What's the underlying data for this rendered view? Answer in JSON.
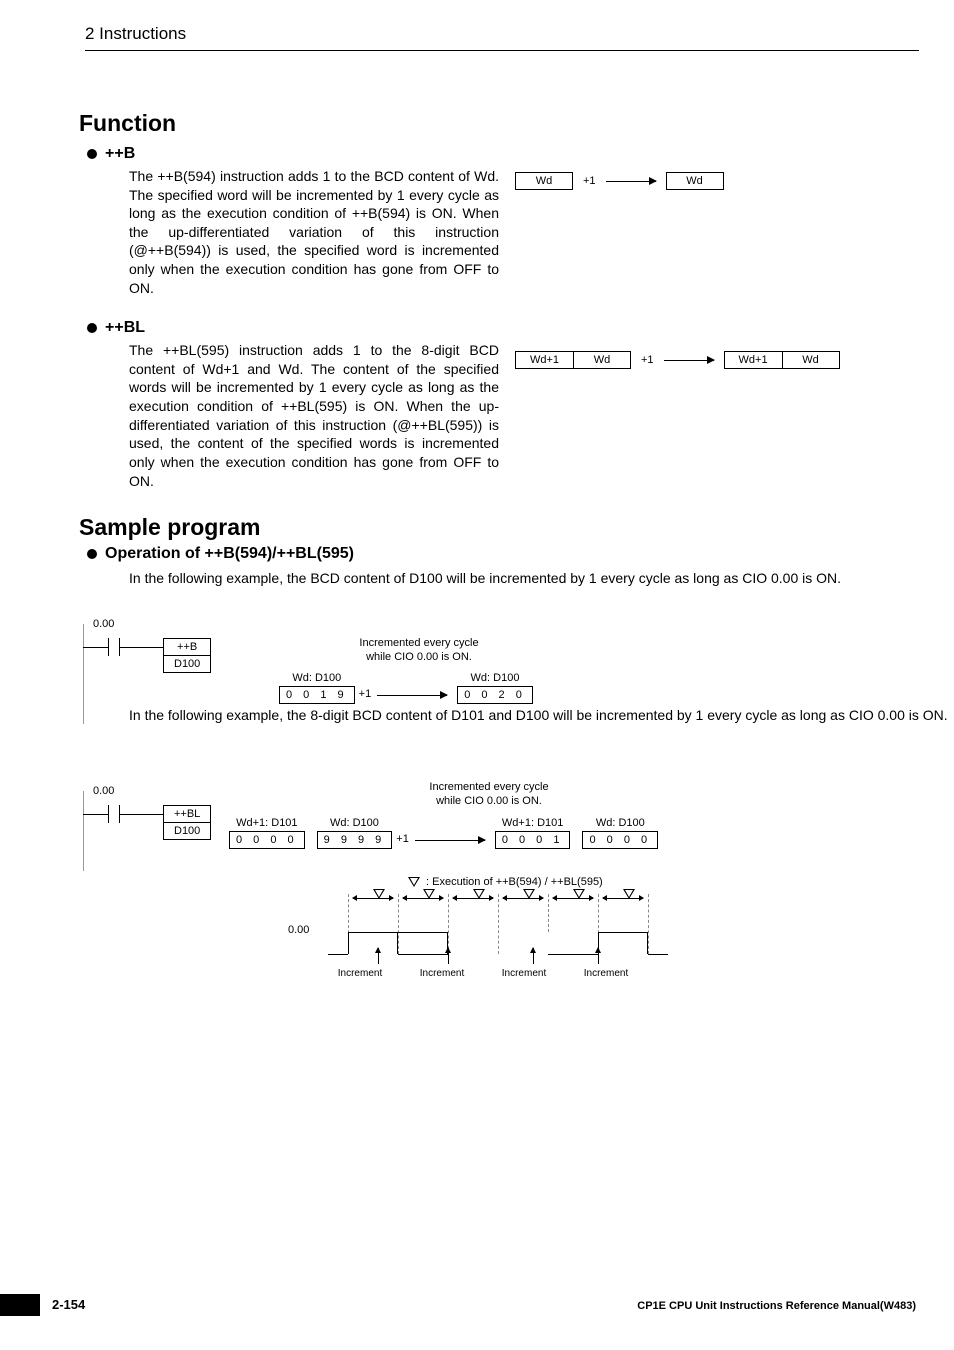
{
  "header": {
    "chapter_title": "2   Instructions"
  },
  "sections": {
    "function_heading": "Function",
    "ppB": {
      "title": "++B",
      "text": "The ++B(594) instruction adds 1 to the BCD content of Wd. The specified word will be incremented by 1 every cycle as long as the execution condition of ++B(594) is ON. When the up-differentiated variation of this instruction (@++B(594)) is used, the specified word is incremented only when the execution condition has gone from OFF to ON."
    },
    "ppBL": {
      "title": "++BL",
      "text": "The ++BL(595) instruction adds 1 to the 8-digit BCD content of Wd+1 and Wd. The content of the specified words will be incremented by 1 every cycle as long as the execution condition of ++BL(595) is ON. When the up-differentiated variation of this instruction (@++BL(595)) is used, the content of the specified words is incremented only when the execution condition has gone from OFF to ON."
    },
    "sample_heading": "Sample program",
    "operation_heading": "Operation of ++B(594)/++BL(595)",
    "sample_para1": "In the following example, the BCD content of D100 will be incremented by 1 every cycle as long as CIO 0.00 is ON.",
    "sample_para2": "In the following example, the 8-digit BCD content of D101 and D100 will be incremented by 1 every cycle as long as CIO 0.00 is ON."
  },
  "diag": {
    "wd": "Wd",
    "wd1": "Wd+1",
    "plus1": "+1"
  },
  "ladder1": {
    "bit": "0.00",
    "mnemonic": "++B",
    "operand": "D100",
    "caption_l1": "Incremented every cycle",
    "caption_l2": "while CIO 0.00 is ON.",
    "before_label": "Wd: D100",
    "before_value": "0 0 1 9",
    "after_label": "Wd: D100",
    "after_value": "0 0 2 0",
    "plus1": "+1"
  },
  "ladder2": {
    "bit": "0.00",
    "mnemonic": "++BL",
    "operand": "D100",
    "caption_l1": "Incremented every cycle",
    "caption_l2": "while CIO 0.00 is ON.",
    "b1_label": "Wd+1: D101",
    "b1_value": "0 0 0 0",
    "b2_label": "Wd: D100",
    "b2_value": "9 9 9 9",
    "a1_label": "Wd+1: D101",
    "a1_value": "0 0 0 1",
    "a2_label": "Wd: D100",
    "a2_value": "0 0 0 0",
    "plus1": "+1"
  },
  "timing": {
    "legend": ": Execution of ++B(594) / ++BL(595)",
    "signal": "0.00",
    "inc": "Increment"
  },
  "footer": {
    "page": "2-154",
    "manual": "CP1E CPU Unit Instructions Reference Manual(W483)"
  }
}
